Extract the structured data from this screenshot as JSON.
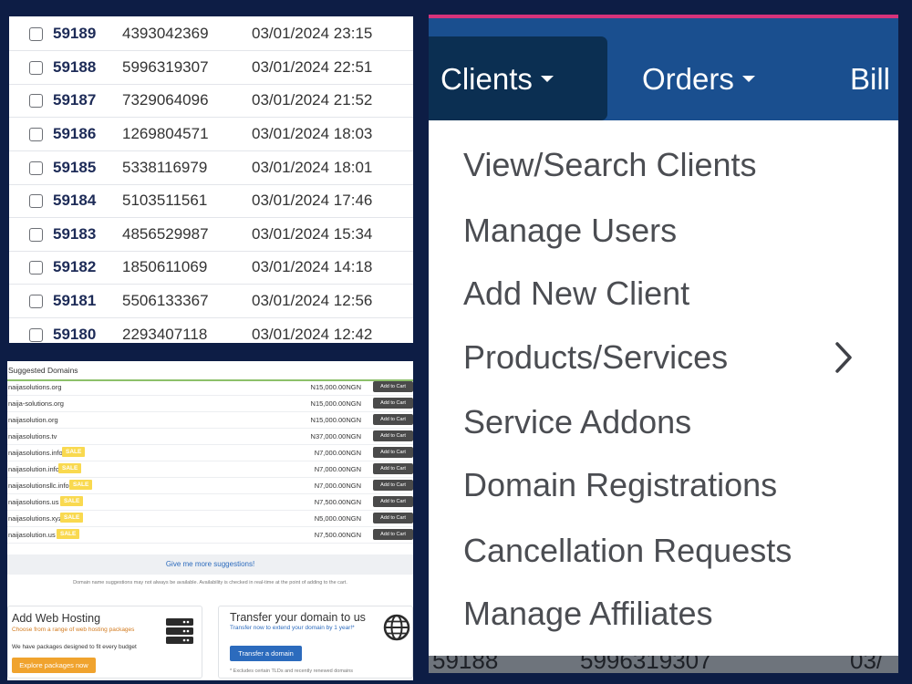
{
  "orders": [
    {
      "id": "59189",
      "phone": "4393042369",
      "date": "03/01/2024 23:15"
    },
    {
      "id": "59188",
      "phone": "5996319307",
      "date": "03/01/2024 22:51"
    },
    {
      "id": "59187",
      "phone": "7329064096",
      "date": "03/01/2024 21:52"
    },
    {
      "id": "59186",
      "phone": "1269804571",
      "date": "03/01/2024 18:03"
    },
    {
      "id": "59185",
      "phone": "5338116979",
      "date": "03/01/2024 18:01"
    },
    {
      "id": "59184",
      "phone": "5103511561",
      "date": "03/01/2024 17:46"
    },
    {
      "id": "59183",
      "phone": "4856529987",
      "date": "03/01/2024 15:34"
    },
    {
      "id": "59182",
      "phone": "1850611069",
      "date": "03/01/2024 14:18"
    },
    {
      "id": "59181",
      "phone": "5506133367",
      "date": "03/01/2024 12:56"
    },
    {
      "id": "59180",
      "phone": "2293407118",
      "date": "03/01/2024 12:42"
    }
  ],
  "domains": {
    "header": "Suggested Domains",
    "add_label": "Add to Cart",
    "sale_label": "SALE",
    "rows": [
      {
        "name": "naijasolutions.org",
        "price": "N15,000.00NGN",
        "sale": false
      },
      {
        "name": "naija-solutions.org",
        "price": "N15,000.00NGN",
        "sale": false
      },
      {
        "name": "naijasolution.org",
        "price": "N15,000.00NGN",
        "sale": false
      },
      {
        "name": "naijasolutions.tv",
        "price": "N37,000.00NGN",
        "sale": false
      },
      {
        "name": "naijasolutions.info",
        "price": "N7,000.00NGN",
        "sale": true
      },
      {
        "name": "naijasolution.info",
        "price": "N7,000.00NGN",
        "sale": true
      },
      {
        "name": "naijasolutionsllc.info",
        "price": "N7,000.00NGN",
        "sale": true
      },
      {
        "name": "naijasolutions.us",
        "price": "N7,500.00NGN",
        "sale": true
      },
      {
        "name": "naijasolutions.xyz",
        "price": "N5,000.00NGN",
        "sale": true
      },
      {
        "name": "naijasolution.us",
        "price": "N7,500.00NGN",
        "sale": true
      }
    ],
    "more": "Give me more suggestions!",
    "note": "Domain name suggestions may not always be available. Availability is checked in real-time at the point of adding to the cart."
  },
  "hosting": {
    "title": "Add Web Hosting",
    "subtitle": "Choose from a range of web hosting packages",
    "text": "We have packages designed to fit every budget",
    "button": "Explore packages now"
  },
  "transfer": {
    "title": "Transfer your domain to us",
    "subtitle": "Transfer now to extend your domain by 1 year!*",
    "button": "Transfer a domain",
    "footnote": "* Excludes certain TLDs and recently renewed domains"
  },
  "nav": {
    "clients": "Clients",
    "orders": "Orders",
    "billing": "Bill"
  },
  "menu": [
    "View/Search Clients",
    "Manage Users",
    "Add New Client",
    "Products/Services",
    "Service Addons",
    "Domain Registrations",
    "Cancellation Requests",
    "Manage Affiliates"
  ],
  "menu_bottom": [
    "59188",
    "5996319307",
    "03/"
  ],
  "colors": {
    "background": "#0d1d45",
    "nav_bar": "#1a4f8f",
    "nav_active": "#0b2f52",
    "accent_pink": "#d6337a",
    "sale_badge": "#f9d94f",
    "link_blue": "#2c6bbd",
    "explore_orange": "#f0a32e"
  }
}
